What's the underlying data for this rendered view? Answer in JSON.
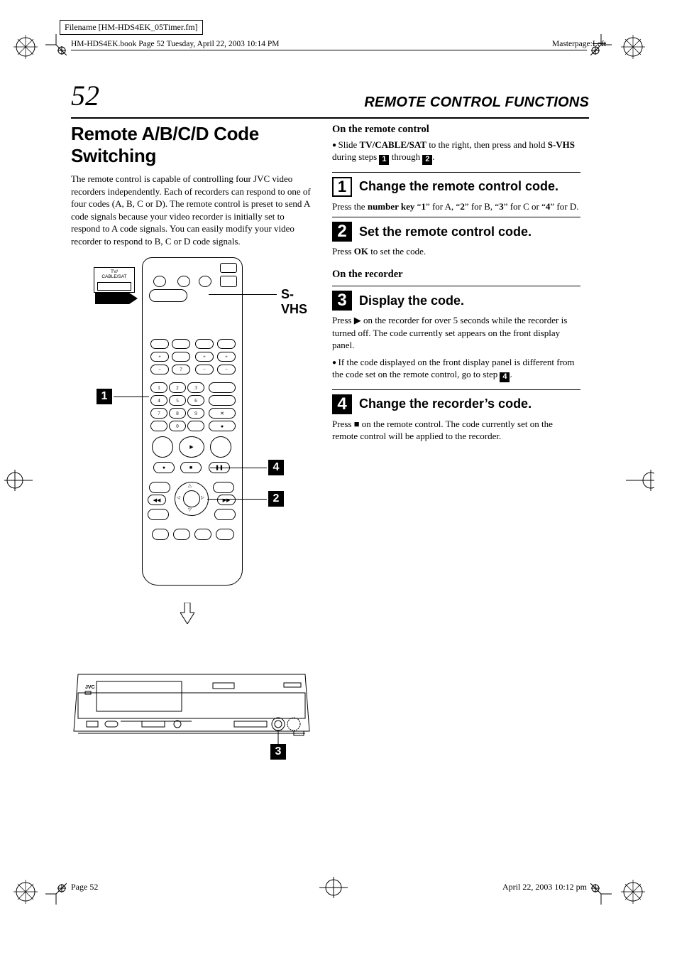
{
  "meta": {
    "filename_box": "Filename [HM-HDS4EK_05Timer.fm]",
    "book_line": "HM-HDS4EK.book  Page 52  Tuesday, April 22, 2003  10:14 PM",
    "masterpage_label": "Masterpage:",
    "masterpage_value": "Left"
  },
  "header": {
    "page_num": "52",
    "section": "REMOTE CONTROL FUNCTIONS"
  },
  "left": {
    "title": "Remote A/B/C/D Code Switching",
    "intro": "The remote control is capable of controlling four JVC video recorders independently. Each of recorders can respond to one of four codes (A, B, C or D). The remote control is preset to send A code signals because your video recorder is initially set to respond to A code signals. You can easily modify your video recorder to respond to B, C or D code signals.",
    "svhs_label": "S-VHS",
    "switch_label": "TV/\nCABLE/SAT"
  },
  "right": {
    "h_remote": "On the remote control",
    "bullet1_pre": "Slide ",
    "bullet1_b1": "TV/CABLE/SAT",
    "bullet1_mid": " to the right, then press and hold ",
    "bullet1_b2": "S-VHS",
    "bullet1_post": " during steps ",
    "bullet1_thru": " through ",
    "bullet1_end": ".",
    "step1_title": "Change the remote control code.",
    "step1_body_a": "Press the ",
    "step1_body_b": "number key",
    "step1_body_c": " “",
    "step1_body_d": "1",
    "step1_body_e": "” for A, “",
    "step1_body_f": "2",
    "step1_body_g": "” for B, “",
    "step1_body_h": "3",
    "step1_body_i": "” for C or “",
    "step1_body_j": "4",
    "step1_body_k": "” for D.",
    "step2_title": "Set the remote control code.",
    "step2_body_a": "Press ",
    "step2_body_b": "OK",
    "step2_body_c": " to set the code.",
    "h_recorder": "On the recorder",
    "step3_title": "Display the code.",
    "step3_body": "Press ▶ on the recorder for over 5 seconds while the recorder is turned off. The code currently set appears on the front display panel.",
    "step3_note_a": "If the code displayed on the front display panel is different from the code set on the remote control, go to step ",
    "step3_note_b": ".",
    "step4_title": "Change the recorder’s code.",
    "step4_body": "Press ■ on the remote control. The code currently set on the remote control will be applied to the recorder."
  },
  "footer": {
    "left": "Page 52",
    "right": "April 22, 2003 10:12 pm"
  },
  "callouts": {
    "c1": "1",
    "c2": "2",
    "c3": "3",
    "c4": "4"
  }
}
